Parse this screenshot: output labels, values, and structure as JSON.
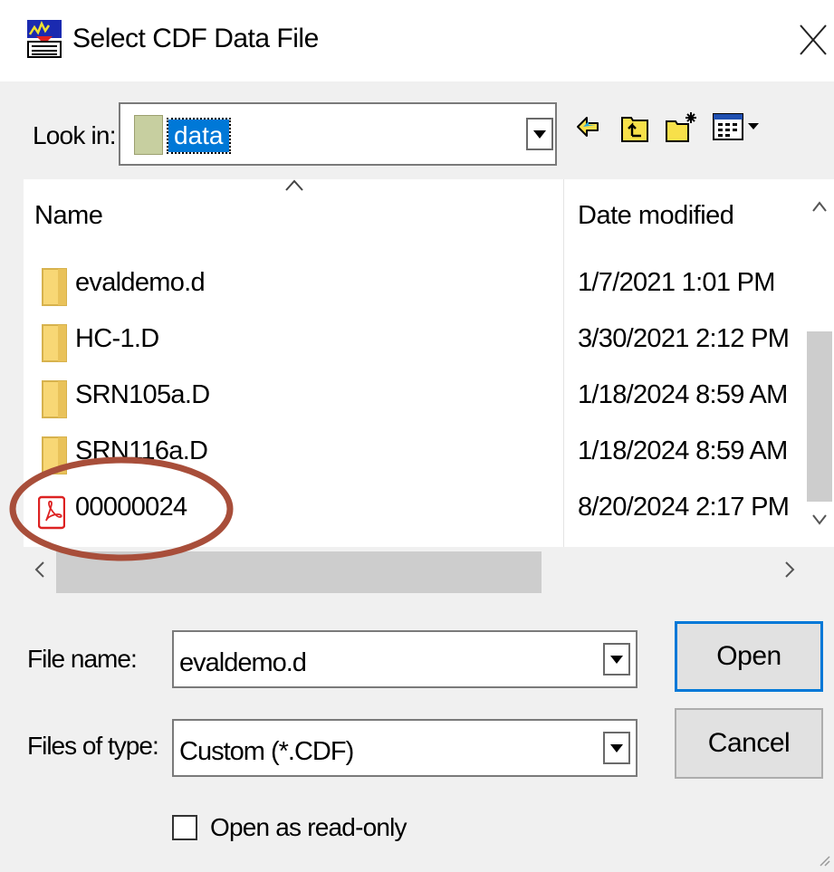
{
  "dialog": {
    "title": "Select CDF Data File"
  },
  "look_in": {
    "label": "Look in:",
    "value": "data"
  },
  "list": {
    "columns": {
      "name": "Name",
      "date_modified": "Date modified"
    },
    "rows": [
      {
        "name": "evaldemo.d",
        "date": "1/7/2021 1:01 PM",
        "icon": "folder-icon"
      },
      {
        "name": "HC-1.D",
        "date": "3/30/2021 2:12 PM",
        "icon": "folder-icon"
      },
      {
        "name": "SRN105a.D",
        "date": "1/18/2024 8:59 AM",
        "icon": "folder-icon"
      },
      {
        "name": "SRN116a.D",
        "date": "1/18/2024 8:59 AM",
        "icon": "folder-icon"
      },
      {
        "name": "00000024",
        "date": "8/20/2024 2:17 PM",
        "icon": "pdf-file-icon"
      }
    ]
  },
  "file_name": {
    "label": "File name:",
    "value": "evaldemo.d"
  },
  "files_of_type": {
    "label": "Files of type:",
    "value": "Custom (*.CDF)"
  },
  "buttons": {
    "open": "Open",
    "cancel": "Cancel"
  },
  "read_only": {
    "label": "Open as read-only",
    "checked": false
  },
  "colors": {
    "selection": "#0078d7",
    "annotation_ellipse": "#a84e3a",
    "folder": "#f8d775"
  }
}
